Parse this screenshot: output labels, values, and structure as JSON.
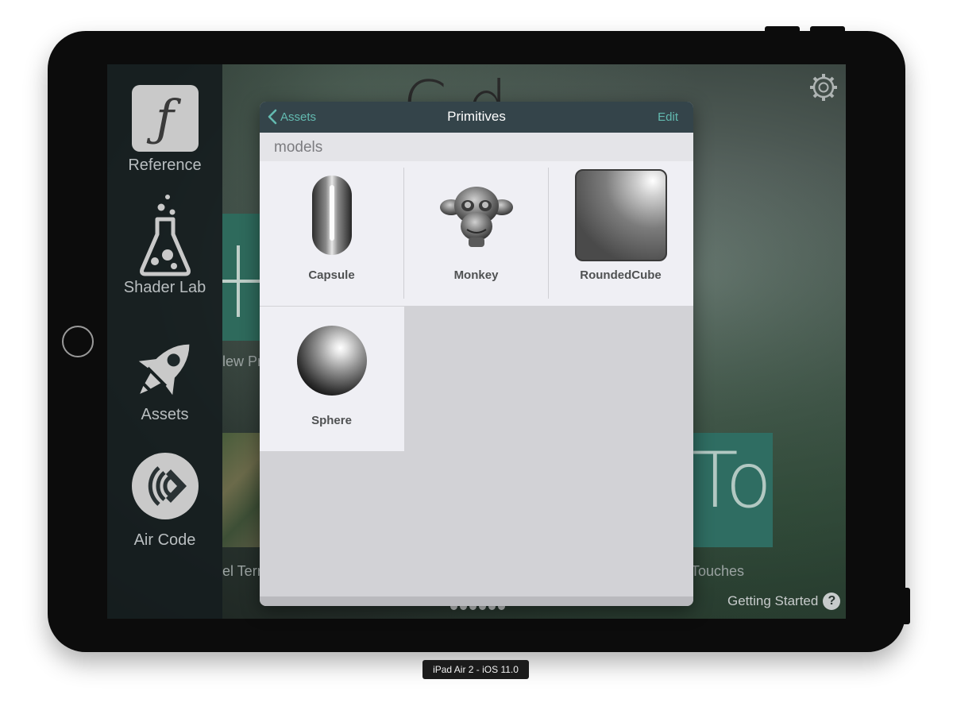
{
  "device_label": "iPad Air 2 - iOS 11.0",
  "sidebar": {
    "items": [
      {
        "label": "Reference",
        "icon": "function-icon"
      },
      {
        "label": "Shader Lab",
        "icon": "flask-icon"
      },
      {
        "label": "Assets",
        "icon": "rocket-icon"
      },
      {
        "label": "Air Code",
        "icon": "air-code-icon"
      }
    ]
  },
  "background": {
    "title_fragment": "C  d",
    "tiles": [
      {
        "label": "lew Pr"
      },
      {
        "label": "el Terr"
      },
      {
        "label": "Touches",
        "tile_text": "To"
      }
    ],
    "getting_started": "Getting Started",
    "help_glyph": "?",
    "settings_icon": "gear-icon"
  },
  "popover": {
    "back_label": "Assets",
    "title": "Primitives",
    "edit_label": "Edit",
    "section": "models",
    "items": [
      {
        "label": "Capsule",
        "icon": "capsule-icon"
      },
      {
        "label": "Monkey",
        "icon": "monkey-icon"
      },
      {
        "label": "RoundedCube",
        "icon": "rounded-cube-icon"
      },
      {
        "label": "Sphere",
        "icon": "sphere-icon"
      }
    ]
  },
  "colors": {
    "header_bg": "#34444a",
    "accent": "#63bab0",
    "cell_bg": "#efeff4",
    "empty_bg": "#d2d2d6"
  }
}
